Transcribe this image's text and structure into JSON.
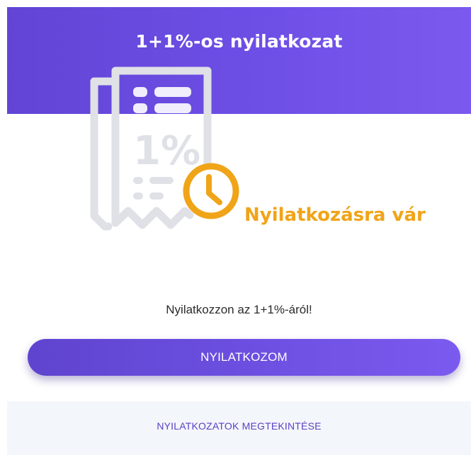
{
  "header": {
    "title": "1+1%-os nyilatkozat"
  },
  "illustration": {
    "icon": "receipt-clock-icon",
    "receipt_label": "1%"
  },
  "status": {
    "text": "Nyilatkozásra vár",
    "color": "#f0a418"
  },
  "prompt": {
    "text": "Nyilatkozzon az 1+1%-áról!"
  },
  "actions": {
    "primary_label": "NYILATKOZOM",
    "secondary_label": "NYILATKOZATOK MEGTEKINTÉSE"
  },
  "colors": {
    "brand": "#6a4de0",
    "accent": "#f0a418",
    "icon_gray": "#dfe1e6"
  }
}
